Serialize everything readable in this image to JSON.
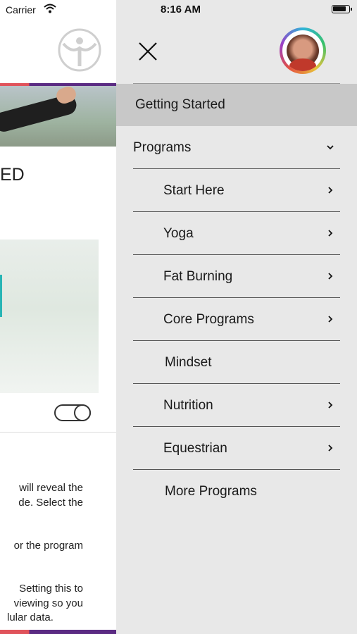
{
  "status_bar": {
    "carrier": "Carrier",
    "time": "8:16 AM"
  },
  "background_page": {
    "partial_heading": "ED",
    "text_lines": [
      "will reveal the",
      "de. Select the",
      "or the program",
      "Setting this to",
      "viewing so you",
      "lular data."
    ],
    "accent_colors": [
      "#e0535b",
      "#5b2b83",
      "#28b5b5"
    ]
  },
  "drawer": {
    "close_icon": "close-icon",
    "avatar_icon": "avatar",
    "menu": [
      {
        "label": "Getting Started",
        "active": true,
        "indent": false,
        "chevron": "none"
      },
      {
        "label": "Programs",
        "active": false,
        "indent": false,
        "chevron": "down"
      },
      {
        "label": "Start Here",
        "active": false,
        "indent": true,
        "chevron": "right"
      },
      {
        "label": "Yoga",
        "active": false,
        "indent": true,
        "chevron": "right"
      },
      {
        "label": "Fat Burning",
        "active": false,
        "indent": true,
        "chevron": "right"
      },
      {
        "label": "Core Programs",
        "active": false,
        "indent": true,
        "chevron": "right"
      },
      {
        "label": "Mindset",
        "active": false,
        "indent": true,
        "chevron": "none"
      },
      {
        "label": "Nutrition",
        "active": false,
        "indent": true,
        "chevron": "right"
      },
      {
        "label": "Equestrian",
        "active": false,
        "indent": true,
        "chevron": "right"
      },
      {
        "label": "More Programs",
        "active": false,
        "indent": true,
        "chevron": "none"
      }
    ]
  }
}
